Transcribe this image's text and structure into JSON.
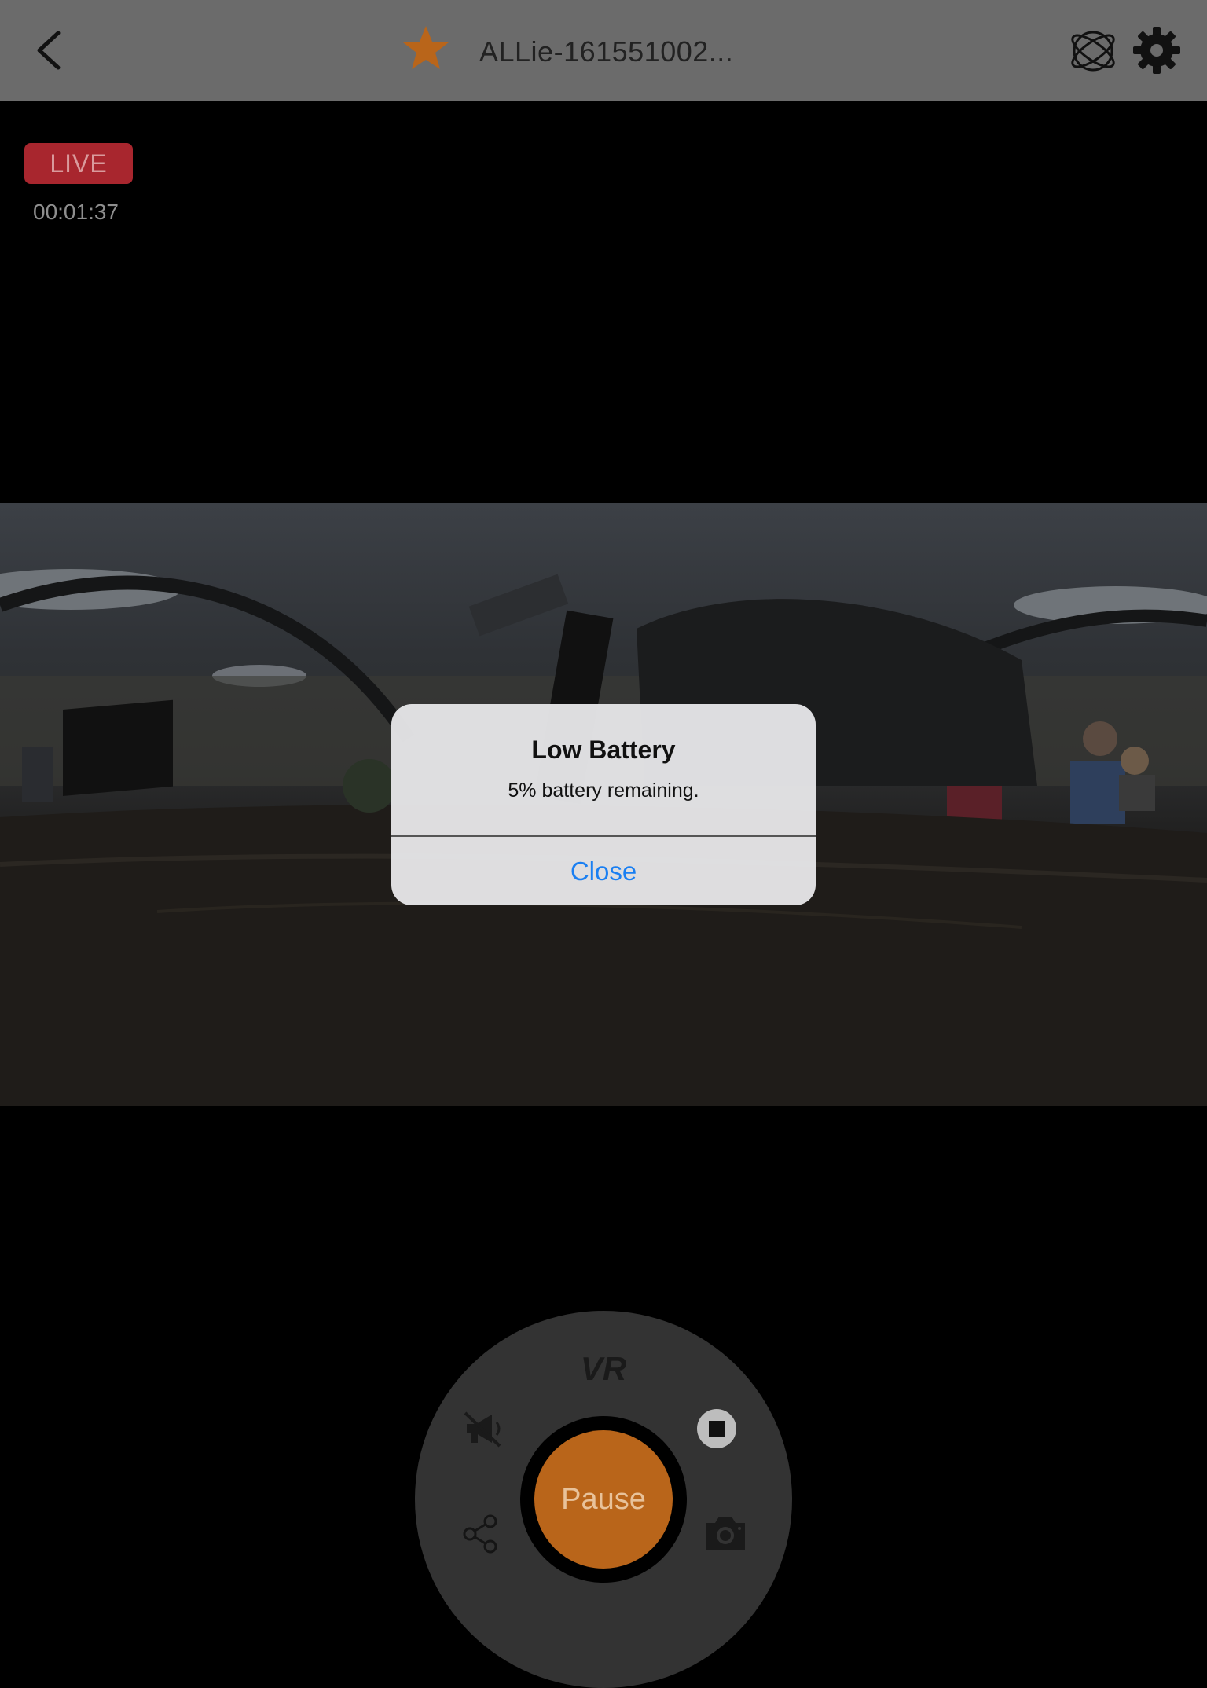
{
  "header": {
    "title": "ALLie-161551002...",
    "icons": {
      "back": "chevron-left-icon",
      "favorite": "star-icon",
      "view_mode": "orbit-icon",
      "settings": "gear-icon"
    }
  },
  "stream": {
    "live_label": "LIVE",
    "elapsed": "00:01:37"
  },
  "alert": {
    "title": "Low Battery",
    "message": "5% battery remaining.",
    "close_label": "Close"
  },
  "controls": {
    "mode_label": "VR",
    "pause_label": "Pause",
    "icons": {
      "mute": "megaphone-muted-icon",
      "stop": "stop-icon",
      "share": "share-icon",
      "snapshot": "camera-icon"
    }
  },
  "colors": {
    "header_bg": "#6b6b6b",
    "accent_orange": "#b9651a",
    "live_red": "#a8262e",
    "alert_link": "#1a7ff2"
  }
}
